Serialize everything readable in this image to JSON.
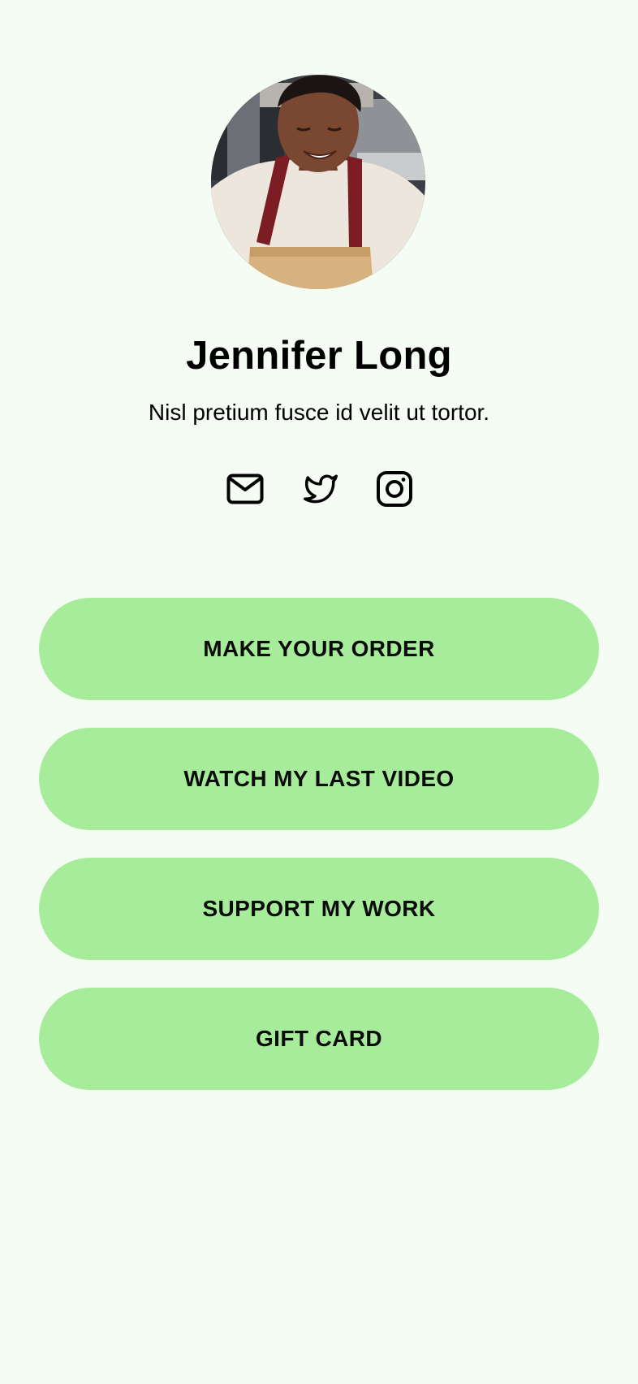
{
  "profile": {
    "avatar_alt": "Jennifer Long",
    "name": "Jennifer Long",
    "bio": "Nisl pretium fusce id velit ut tortor."
  },
  "socials": [
    {
      "icon": "mail-icon"
    },
    {
      "icon": "twitter-icon"
    },
    {
      "icon": "instagram-icon"
    }
  ],
  "links": [
    {
      "label": "MAKE YOUR ORDER"
    },
    {
      "label": "WATCH MY LAST VIDEO"
    },
    {
      "label": "SUPPORT MY WORK"
    },
    {
      "label": "GIFT CARD"
    }
  ],
  "colors": {
    "background": "#f5fcf3",
    "button": "#a7ec9b",
    "text": "#000000"
  }
}
